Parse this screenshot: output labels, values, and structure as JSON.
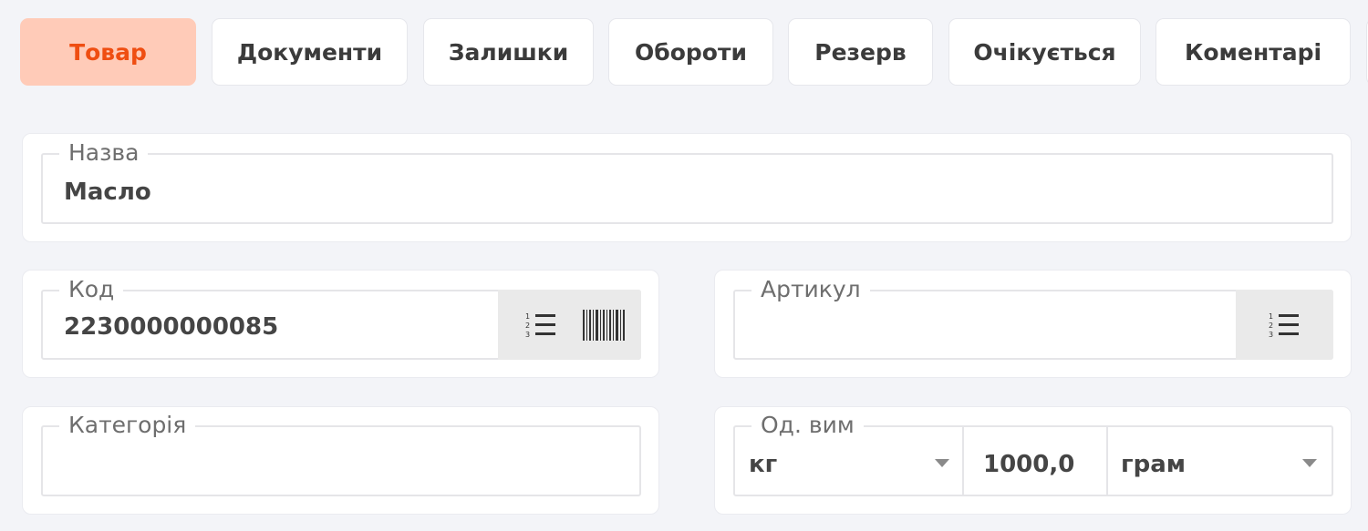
{
  "tabs": [
    {
      "label": "Товар",
      "active": true
    },
    {
      "label": "Документи"
    },
    {
      "label": "Залишки"
    },
    {
      "label": "Обороти"
    },
    {
      "label": "Резерв"
    },
    {
      "label": "Очікується"
    },
    {
      "label": "Коментарі"
    }
  ],
  "form": {
    "name": {
      "label": "Назва",
      "value": "Масло"
    },
    "code": {
      "label": "Код",
      "value": "2230000000085"
    },
    "article": {
      "label": "Артикул",
      "value": ""
    },
    "category": {
      "label": "Категорія",
      "value": ""
    },
    "unit": {
      "label": "Од. вим",
      "unit_value": "кг",
      "quantity": "1000,0",
      "sub_unit": "грам"
    }
  },
  "icons": {
    "code_list": "numbered-list-icon",
    "code_barcode": "barcode-icon",
    "article_list": "numbered-list-icon",
    "dropdown": "chevron-down-icon"
  },
  "colors": {
    "active_tab_bg": "#ffcbb8",
    "active_tab_text": "#ef4e12",
    "page_bg": "#f3f4f8"
  }
}
